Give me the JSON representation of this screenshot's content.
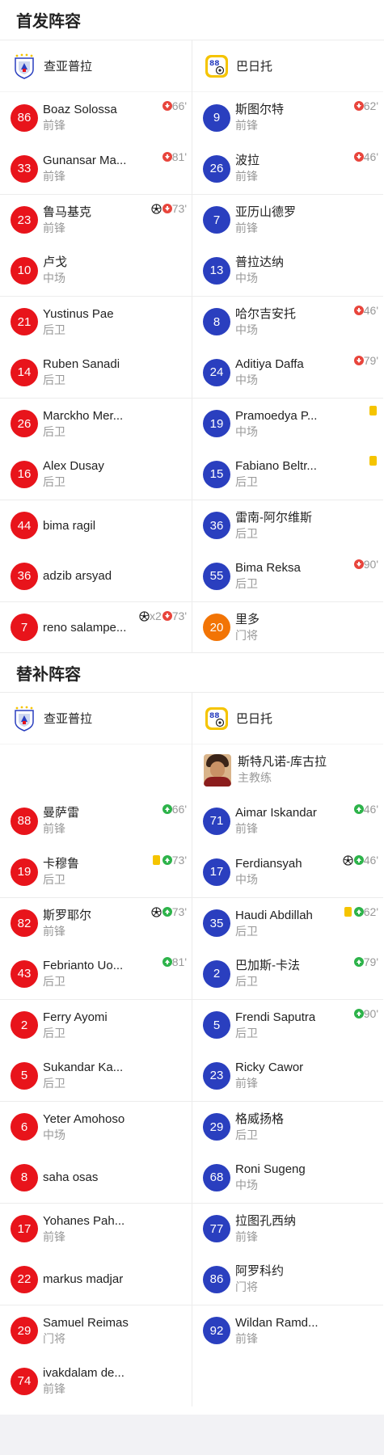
{
  "starting": {
    "title": "首发阵容",
    "home": {
      "team_name": "查亚普拉",
      "players": [
        {
          "number": "86",
          "name": "Boaz Solossa",
          "position": "前锋",
          "events": [
            {
              "type": "sub-out",
              "minute": "66'"
            }
          ]
        },
        {
          "number": "33",
          "name": "Gunansar Ma...",
          "position": "前锋",
          "events": [
            {
              "type": "sub-out",
              "minute": "81'"
            }
          ]
        },
        {
          "number": "23",
          "name": "鲁马基克",
          "position": "前锋",
          "events": [
            {
              "type": "goal"
            },
            {
              "type": "sub-out",
              "minute": "73'"
            }
          ]
        },
        {
          "number": "10",
          "name": "卢戈",
          "position": "中场",
          "events": []
        },
        {
          "number": "21",
          "name": "Yustinus Pae",
          "position": "后卫",
          "events": []
        },
        {
          "number": "14",
          "name": "Ruben Sanadi",
          "position": "后卫",
          "events": []
        },
        {
          "number": "26",
          "name": "Marckho Mer...",
          "position": "后卫",
          "events": []
        },
        {
          "number": "16",
          "name": "Alex Dusay",
          "position": "后卫",
          "events": []
        },
        {
          "number": "44",
          "name": "bima ragil",
          "position": "",
          "events": []
        },
        {
          "number": "36",
          "name": "adzib arsyad",
          "position": "",
          "events": []
        },
        {
          "number": "7",
          "name": "reno salampe...",
          "position": "",
          "events": [
            {
              "type": "goal"
            },
            {
              "type": "count",
              "text": "x2"
            },
            {
              "type": "sub-out",
              "minute": "73'"
            }
          ]
        }
      ]
    },
    "away": {
      "team_name": "巴日托",
      "players": [
        {
          "number": "9",
          "name": "斯图尔特",
          "position": "前锋",
          "color": "blue",
          "events": [
            {
              "type": "sub-out",
              "minute": "62'"
            }
          ]
        },
        {
          "number": "26",
          "name": "波拉",
          "position": "前锋",
          "color": "blue",
          "events": [
            {
              "type": "sub-out",
              "minute": "46'"
            }
          ]
        },
        {
          "number": "7",
          "name": "亚历山德罗",
          "position": "前锋",
          "color": "blue",
          "events": []
        },
        {
          "number": "13",
          "name": "普拉达纳",
          "position": "中场",
          "color": "blue",
          "events": []
        },
        {
          "number": "8",
          "name": "哈尔吉安托",
          "position": "中场",
          "color": "blue",
          "events": [
            {
              "type": "sub-out",
              "minute": "46'"
            }
          ]
        },
        {
          "number": "24",
          "name": "Aditiya Daffa",
          "position": "中场",
          "color": "blue",
          "events": [
            {
              "type": "sub-out",
              "minute": "79'"
            }
          ]
        },
        {
          "number": "19",
          "name": "Pramoedya P...",
          "position": "中场",
          "color": "blue",
          "events": [
            {
              "type": "yellow"
            }
          ]
        },
        {
          "number": "15",
          "name": "Fabiano Beltr...",
          "position": "后卫",
          "color": "blue",
          "events": [
            {
              "type": "yellow"
            }
          ]
        },
        {
          "number": "36",
          "name": "雷南-阿尔维斯",
          "position": "后卫",
          "color": "blue",
          "events": []
        },
        {
          "number": "55",
          "name": "Bima Reksa",
          "position": "后卫",
          "color": "blue",
          "events": [
            {
              "type": "sub-out",
              "minute": "90'"
            }
          ]
        },
        {
          "number": "20",
          "name": "里多",
          "position": "门将",
          "color": "orange",
          "events": []
        }
      ]
    }
  },
  "subs": {
    "title": "替补阵容",
    "home": {
      "team_name": "查亚普拉",
      "players": [
        {
          "number": "88",
          "name": "曼萨雷",
          "position": "前锋",
          "events": [
            {
              "type": "sub-in",
              "minute": "66'"
            }
          ]
        },
        {
          "number": "19",
          "name": "卡穆鲁",
          "position": "后卫",
          "events": [
            {
              "type": "yellow"
            },
            {
              "type": "sub-in",
              "minute": "73'"
            }
          ]
        },
        {
          "number": "82",
          "name": "斯罗耶尔",
          "position": "前锋",
          "events": [
            {
              "type": "goal"
            },
            {
              "type": "sub-in",
              "minute": "73'"
            }
          ]
        },
        {
          "number": "43",
          "name": "Febrianto Uo...",
          "position": "后卫",
          "events": [
            {
              "type": "sub-in",
              "minute": "81'"
            }
          ]
        },
        {
          "number": "2",
          "name": "Ferry Ayomi",
          "position": "后卫",
          "events": []
        },
        {
          "number": "5",
          "name": "Sukandar Ka...",
          "position": "后卫",
          "events": []
        },
        {
          "number": "6",
          "name": "Yeter Amohoso",
          "position": "中场",
          "events": []
        },
        {
          "number": "8",
          "name": "saha osas",
          "position": "",
          "events": []
        },
        {
          "number": "17",
          "name": "Yohanes Pah...",
          "position": "前锋",
          "events": []
        },
        {
          "number": "22",
          "name": "markus madjar",
          "position": "",
          "events": []
        },
        {
          "number": "29",
          "name": "Samuel Reimas",
          "position": "门将",
          "events": []
        },
        {
          "number": "74",
          "name": "ivakdalam de...",
          "position": "前锋",
          "events": []
        }
      ]
    },
    "away": {
      "team_name": "巴日托",
      "coach": {
        "name": "斯特凡诺-库古拉",
        "role": "主教练"
      },
      "players": [
        {
          "number": "71",
          "name": "Aimar Iskandar",
          "position": "前锋",
          "events": [
            {
              "type": "sub-in",
              "minute": "46'"
            }
          ]
        },
        {
          "number": "17",
          "name": "Ferdiansyah",
          "position": "中场",
          "events": [
            {
              "type": "goal"
            },
            {
              "type": "sub-in",
              "minute": "46'"
            }
          ]
        },
        {
          "number": "35",
          "name": "Haudi Abdillah",
          "position": "后卫",
          "events": [
            {
              "type": "yellow"
            },
            {
              "type": "sub-in",
              "minute": "62'"
            }
          ]
        },
        {
          "number": "2",
          "name": "巴加斯-卡法",
          "position": "后卫",
          "events": [
            {
              "type": "sub-in",
              "minute": "79'"
            }
          ]
        },
        {
          "number": "5",
          "name": "Frendi Saputra",
          "position": "后卫",
          "events": [
            {
              "type": "sub-in",
              "minute": "90'"
            }
          ]
        },
        {
          "number": "23",
          "name": "Ricky Cawor",
          "position": "前锋",
          "events": []
        },
        {
          "number": "29",
          "name": "格威扬格",
          "position": "后卫",
          "events": []
        },
        {
          "number": "68",
          "name": "Roni Sugeng",
          "position": "中场",
          "events": []
        },
        {
          "number": "77",
          "name": "拉图孔西纳",
          "position": "前锋",
          "events": []
        },
        {
          "number": "86",
          "name": "阿罗科约",
          "position": "门将",
          "events": []
        },
        {
          "number": "92",
          "name": "Wildan Ramd...",
          "position": "前锋",
          "events": []
        }
      ]
    }
  },
  "colors": {
    "home_number": "#e8141b",
    "away_number": "#2a3fbf",
    "goalkeeper_number": "#f27405",
    "sub_out": "#e8453c",
    "sub_in": "#2db34a",
    "yellow_card": "#f5c400"
  }
}
